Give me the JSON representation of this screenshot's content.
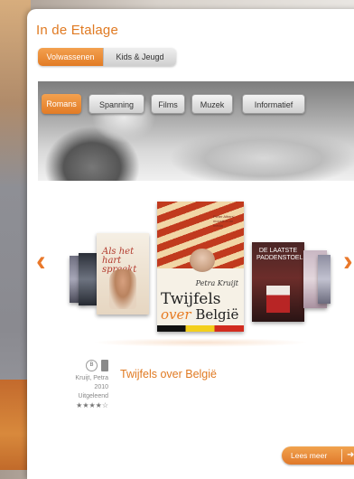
{
  "panel": {
    "title": "In de Etalage"
  },
  "audience_tabs": [
    {
      "label": "Volwassenen",
      "active": true
    },
    {
      "label": "Kids & Jeugd",
      "active": false
    }
  ],
  "genres": [
    {
      "label": "Romans",
      "active": true
    },
    {
      "label": "Spanning",
      "active": false
    },
    {
      "label": "Films",
      "active": false
    },
    {
      "label": "Muzek",
      "active": false
    },
    {
      "label": "Informatief",
      "active": false
    }
  ],
  "carousel": {
    "prev_icon": "chevron-left-icon",
    "next_icon": "chevron-right-icon",
    "books": [
      {
        "cover_text": "Als het hart spreekt"
      },
      {
        "cover_small": "Pieter Albers' moordt in de media",
        "author": "Petra Kruijt",
        "title_line1": "Twijfels",
        "title_over": "over",
        "title_rest": "België"
      },
      {
        "cover_text": "DE LAATSTE PADDENSTOEL"
      }
    ]
  },
  "selected_book": {
    "title": "Twijfels over België",
    "author": "Kruijt, Petra",
    "year": "2010",
    "status": "Uitgeleend",
    "rating_stars": "★★★★☆",
    "rating_value": 4
  },
  "read_more": {
    "label": "Lees meer",
    "icon": "arrow-right-icon"
  },
  "colors": {
    "accent": "#e27b25",
    "title": "#e07a22"
  }
}
